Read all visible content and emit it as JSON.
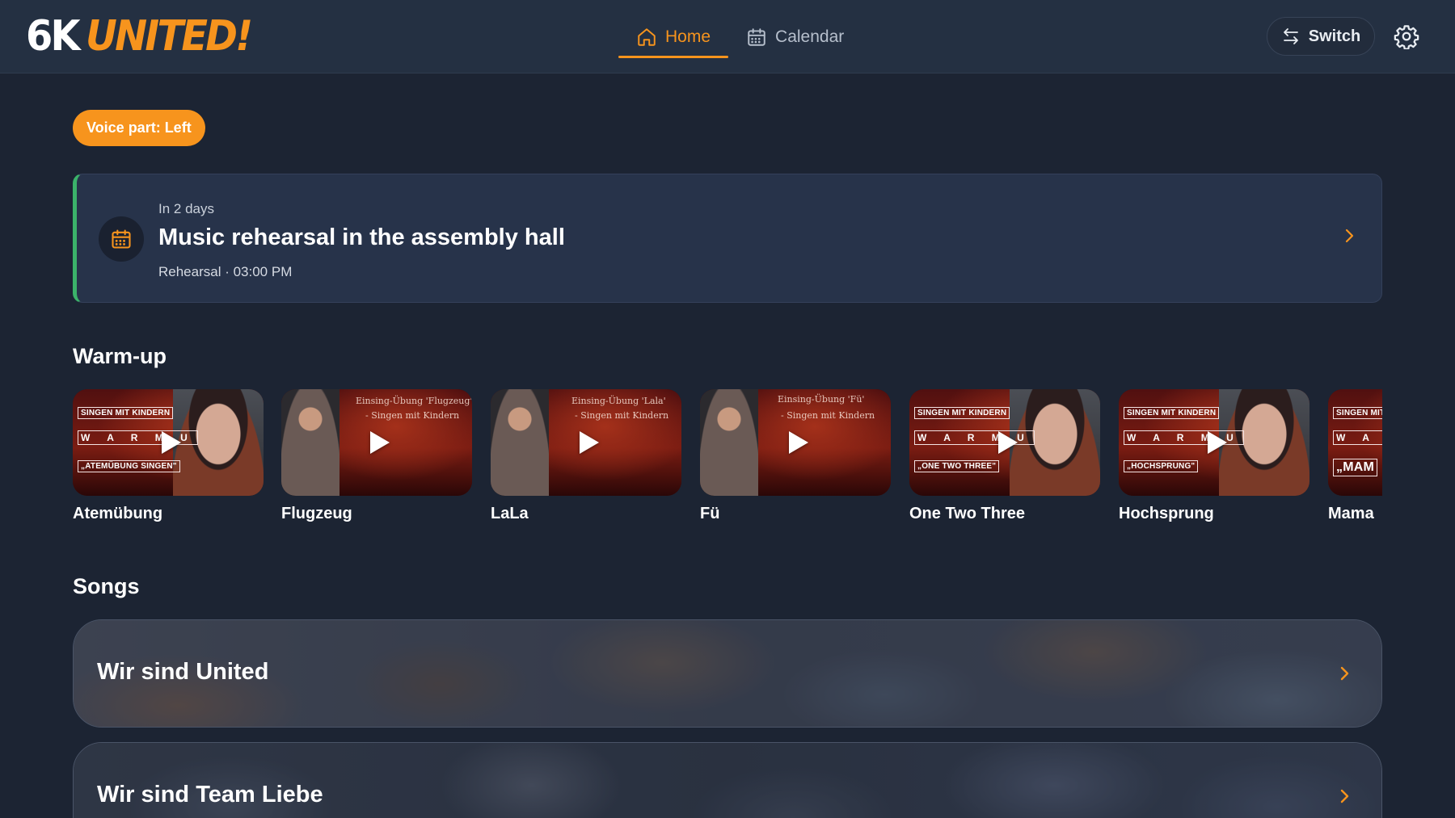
{
  "brand": {
    "part1": "6K",
    "part2": "UNITED!",
    "accent": "#f7941d"
  },
  "nav": {
    "tabs": [
      {
        "label": "Home",
        "icon": "home-icon",
        "active": true
      },
      {
        "label": "Calendar",
        "icon": "calendar-icon",
        "active": false
      }
    ]
  },
  "header_actions": {
    "switch_label": "Switch",
    "settings_icon": "gear-icon"
  },
  "voice_part": "Voice part: Left",
  "event": {
    "when": "In 2 days",
    "title": "Music rehearsal in the assembly hall",
    "meta": "Rehearsal · 03:00 PM",
    "accent": "#3bb36a"
  },
  "warmup": {
    "title": "Warm-up",
    "videos": [
      {
        "title": "Atemübung",
        "style": "portrait",
        "tag1": "SINGEN MIT KINDERN",
        "tag2": "W A R M  U",
        "tag3": "„ATEMÜBUNG SINGEN\""
      },
      {
        "title": "Flugzeug",
        "style": "stage",
        "line1": "Einsing-Übung 'Flugzeug'",
        "line2": "- Singen mit Kindern"
      },
      {
        "title": "LaLa",
        "style": "stage",
        "line1": "Einsing-Übung 'Lala'",
        "line2": "- Singen mit Kindern"
      },
      {
        "title": "Fü",
        "style": "stage",
        "line1": "Einsing-Übung 'Fü'",
        "line2": "- Singen mit Kindern"
      },
      {
        "title": "One Two Three",
        "style": "portrait",
        "tag1": "SINGEN MIT KINDERN",
        "tag2": "W A R M  U",
        "tag3": "„ONE TWO THREE\""
      },
      {
        "title": "Hochsprung",
        "style": "portrait",
        "tag1": "SINGEN MIT KINDERN",
        "tag2": "W A R M  U",
        "tag3": "„HOCHSPRUNG\""
      },
      {
        "title": "Mama",
        "style": "portrait",
        "tag1": "SINGEN MIT",
        "tag2": "W A R M",
        "tag3": "„MAM"
      }
    ]
  },
  "songs": {
    "title": "Songs",
    "items": [
      {
        "title": "Wir sind United"
      },
      {
        "title": "Wir sind Team Liebe"
      }
    ]
  }
}
